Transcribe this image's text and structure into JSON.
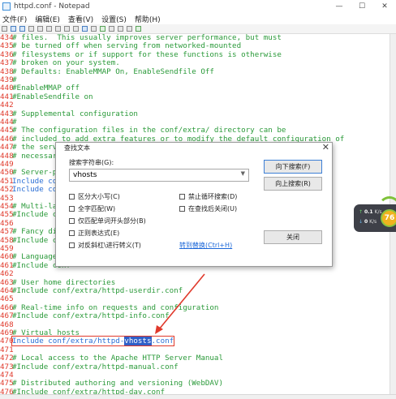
{
  "window": {
    "title": "httpd.conf - Notepad",
    "controls": {
      "minimize": "—",
      "maximize": "☐",
      "close": "✕"
    }
  },
  "menu": [
    "文件(F)",
    "编辑(E)",
    "查看(V)",
    "设置(S)",
    "帮助(H)"
  ],
  "editor": {
    "lines": [
      {
        "num": "434",
        "text": "# files.  This usually improves server performance, but must",
        "kind": "comment"
      },
      {
        "num": "435",
        "text": "# be turned off when serving from networked-mounted",
        "kind": "comment"
      },
      {
        "num": "436",
        "text": "# filesystems or if support for these functions is otherwise",
        "kind": "comment"
      },
      {
        "num": "437",
        "text": "# broken on your system.",
        "kind": "comment"
      },
      {
        "num": "438",
        "text": "# Defaults: EnableMMAP On, EnableSendfile Off",
        "kind": "comment"
      },
      {
        "num": "439",
        "text": "#",
        "kind": "comment"
      },
      {
        "num": "440",
        "text": "#EnableMMAP off",
        "kind": "comment"
      },
      {
        "num": "441",
        "text": "#EnableSendfile on",
        "kind": "comment"
      },
      {
        "num": "442",
        "text": "",
        "kind": "comment"
      },
      {
        "num": "443",
        "text": "# Supplemental configuration",
        "kind": "comment"
      },
      {
        "num": "444",
        "text": "#",
        "kind": "comment"
      },
      {
        "num": "445",
        "text": "# The configuration files in the conf/extra/ directory can be",
        "kind": "comment"
      },
      {
        "num": "446",
        "text": "# included to add extra features or to modify the default configuration of",
        "kind": "comment"
      },
      {
        "num": "447",
        "text": "# the server",
        "kind": "comment"
      },
      {
        "num": "448",
        "text": "# necessary.",
        "kind": "comment"
      },
      {
        "num": "449",
        "text": "",
        "kind": "comment"
      },
      {
        "num": "450",
        "text": "# Server-poo",
        "kind": "comment"
      },
      {
        "num": "451",
        "text": "Include conf",
        "kind": "include"
      },
      {
        "num": "452",
        "text": "Include conf",
        "kind": "include"
      },
      {
        "num": "453",
        "text": "",
        "kind": "comment"
      },
      {
        "num": "454",
        "text": "# Multi-langu",
        "kind": "comment"
      },
      {
        "num": "455",
        "text": "#Include conf",
        "kind": "comment"
      },
      {
        "num": "456",
        "text": "",
        "kind": "comment"
      },
      {
        "num": "457",
        "text": "# Fancy direc",
        "kind": "comment"
      },
      {
        "num": "458",
        "text": "#Include conf",
        "kind": "comment"
      },
      {
        "num": "459",
        "text": "",
        "kind": "comment"
      },
      {
        "num": "460",
        "text": "# Language se",
        "kind": "comment"
      },
      {
        "num": "461",
        "text": "#Include conf",
        "kind": "comment"
      },
      {
        "num": "462",
        "text": "",
        "kind": "comment"
      },
      {
        "num": "463",
        "text": "# User home directories",
        "kind": "comment"
      },
      {
        "num": "464",
        "text": "#Include conf/extra/httpd-userdir.conf",
        "kind": "comment"
      },
      {
        "num": "465",
        "text": "",
        "kind": "comment"
      },
      {
        "num": "466",
        "text": "# Real-time info on requests and configuration",
        "kind": "comment"
      },
      {
        "num": "467",
        "text": "#Include conf/extra/httpd-info.conf",
        "kind": "comment"
      },
      {
        "num": "468",
        "text": "",
        "kind": "comment"
      },
      {
        "num": "469",
        "text": "# Virtual hosts",
        "kind": "comment"
      },
      {
        "num": "470",
        "text_before": "Include conf/extra/httpd-",
        "text_match": "vhosts",
        "text_after": ".conf",
        "kind": "include-match"
      },
      {
        "num": "471",
        "text": "",
        "kind": "comment"
      },
      {
        "num": "472",
        "text": "# Local access to the Apache HTTP Server Manual",
        "kind": "comment"
      },
      {
        "num": "473",
        "text": "#Include conf/extra/httpd-manual.conf",
        "kind": "comment"
      },
      {
        "num": "474",
        "text": "",
        "kind": "comment"
      },
      {
        "num": "475",
        "text": "# Distributed authoring and versioning (WebDAV)",
        "kind": "comment"
      },
      {
        "num": "476",
        "text": "#Include conf/extra/httpd-dav.conf",
        "kind": "comment"
      }
    ]
  },
  "find_dialog": {
    "title": "查找文本",
    "close": "✕",
    "search_label": "搜索字符串(G):",
    "search_value": "vhosts",
    "dropdown_glyph": "▼",
    "options_left": [
      {
        "label": "区分大小写(C)",
        "checked": false
      },
      {
        "label": "全字匹配(W)",
        "checked": false
      },
      {
        "label": "仅匹配单词开头部分(B)",
        "checked": false
      },
      {
        "label": "正则表达式(E)",
        "checked": false
      },
      {
        "label": "对反斜杠\\进行转义(T)",
        "checked": false
      }
    ],
    "options_right": [
      {
        "label": "禁止循环搜索(D)",
        "checked": false
      },
      {
        "label": "在查找后关闭(U)",
        "checked": false
      }
    ],
    "buttons": {
      "find_next": "向下搜索(F)",
      "find_prev": "向上搜索(R)",
      "close": "关闭"
    },
    "replace_link": "转到替换(Ctrl+H)"
  },
  "widget": {
    "upload": "0.1",
    "upload_unit": "K/s",
    "download": "0",
    "download_unit": "K/s",
    "badge": "76"
  },
  "colors": {
    "line_number": "#e0392b",
    "comment": "#2b9a3a",
    "include": "#2b6fd6",
    "selection": "#2f5fc8",
    "annotation_arrow": "#e0392b"
  }
}
